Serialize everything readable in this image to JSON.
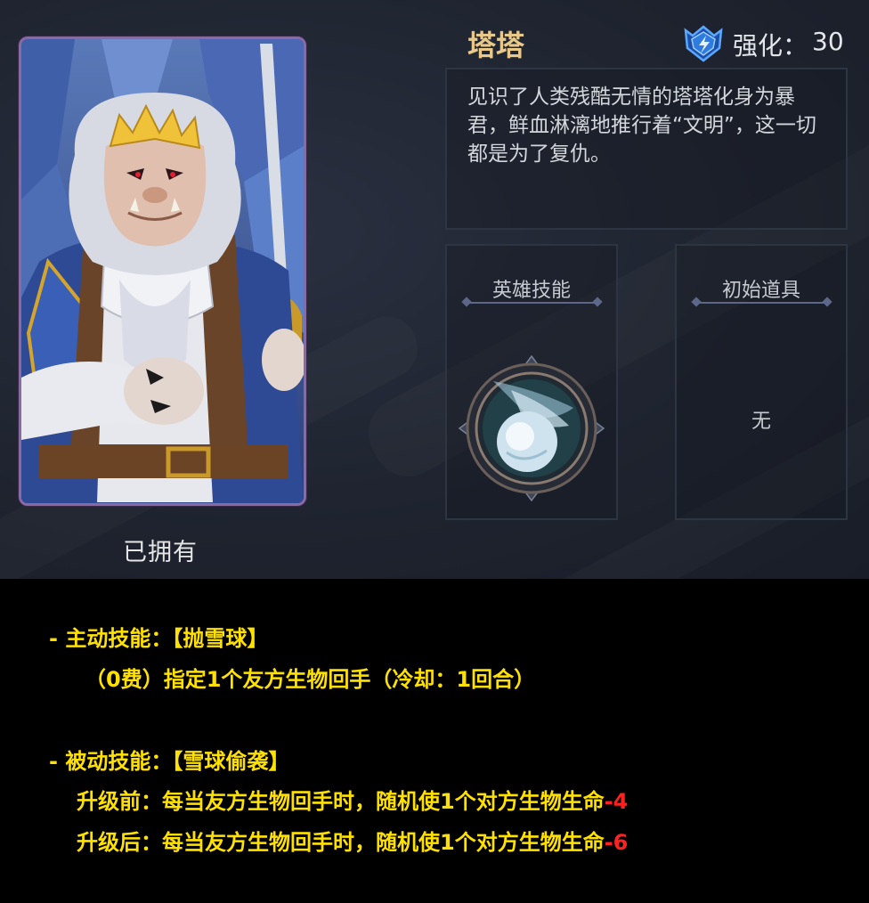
{
  "hero": {
    "name": "塔塔",
    "owned_label": "已拥有",
    "enhance_label": "强化：",
    "enhance_value": "30",
    "description": "见识了人类残酷无情的塔塔化身为暴君，鲜血淋漓地推行着“文明”，这一切都是为了复仇。"
  },
  "panels": {
    "skill_title": "英雄技能",
    "item_title": "初始道具",
    "item_value": "无"
  },
  "icons": {
    "rank": "rank-shield-icon",
    "skill": "snowball-skill-icon"
  },
  "notes": {
    "active_heading": "- 主动技能：【抛雪球】",
    "active_detail": "（0费）指定1个友方生物回手（冷却：1回合）",
    "passive_heading": "- 被动技能：【雪球偷袭】",
    "before_text": "升级前：每当友方生物回手时，随机使1个对方生物生命",
    "before_value": "-4",
    "after_text": "升级后：每当友方生物回手时，随机使1个对方生物生命",
    "after_value": "-6"
  },
  "colors": {
    "accent_gold": "#e8c98a",
    "note_yellow": "#ffe100",
    "note_red": "#ff2020",
    "card_border": "#8a6aa6"
  }
}
